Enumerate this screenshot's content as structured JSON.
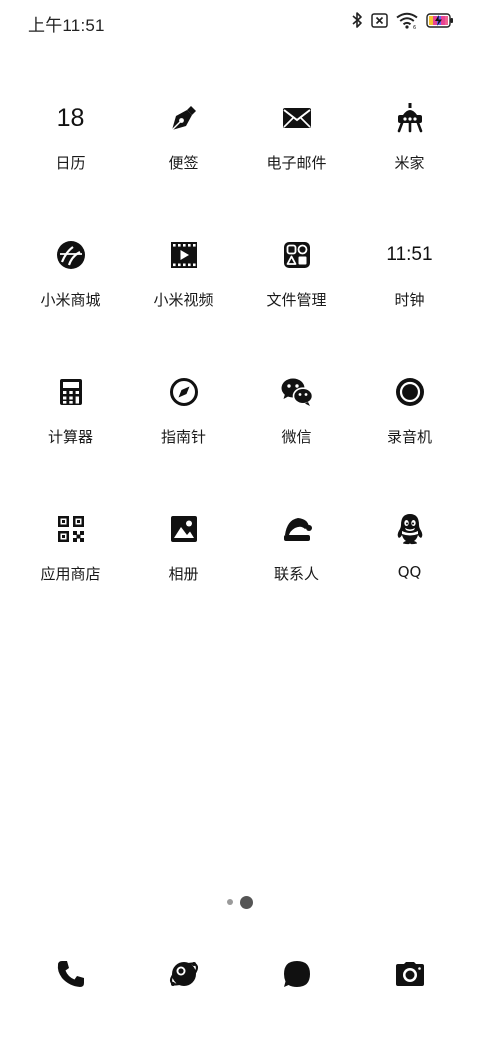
{
  "status_bar": {
    "time": "上午11:51",
    "icons": [
      "bluetooth-icon",
      "no-sim-icon",
      "wifi-icon",
      "battery-charging-icon"
    ]
  },
  "apps": [
    {
      "label": "日历",
      "icon": "calendar-icon",
      "icon_text": "18"
    },
    {
      "label": "便签",
      "icon": "notes-pen-icon"
    },
    {
      "label": "电子邮件",
      "icon": "email-icon"
    },
    {
      "label": "米家",
      "icon": "mijia-icon"
    },
    {
      "label": "小米商城",
      "icon": "mi-store-icon"
    },
    {
      "label": "小米视频",
      "icon": "video-icon"
    },
    {
      "label": "文件管理",
      "icon": "file-manager-icon"
    },
    {
      "label": "时钟",
      "icon": "clock-icon",
      "icon_text": "11:51"
    },
    {
      "label": "计算器",
      "icon": "calculator-icon"
    },
    {
      "label": "指南针",
      "icon": "compass-icon"
    },
    {
      "label": "微信",
      "icon": "wechat-icon"
    },
    {
      "label": "录音机",
      "icon": "recorder-icon"
    },
    {
      "label": "应用商店",
      "icon": "app-store-icon"
    },
    {
      "label": "相册",
      "icon": "gallery-icon"
    },
    {
      "label": "联系人",
      "icon": "contacts-icon"
    },
    {
      "label": "QQ",
      "icon": "qq-icon"
    }
  ],
  "page_indicator": {
    "pages": 2,
    "current": 2
  },
  "dock": [
    {
      "icon": "phone-icon"
    },
    {
      "icon": "browser-icon"
    },
    {
      "icon": "messages-icon"
    },
    {
      "icon": "camera-icon"
    }
  ]
}
